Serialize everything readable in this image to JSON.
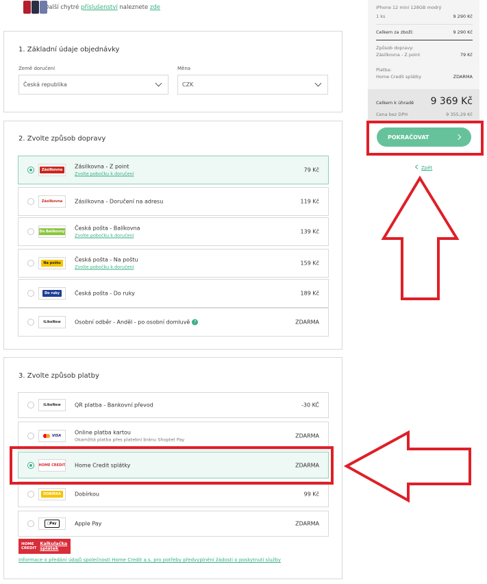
{
  "top_notice": {
    "prefix": "Další chytré",
    "accessories_link": "příslušenství",
    "middle": "naleznete",
    "here_link": "zde"
  },
  "order_basics": {
    "title": "1. Základní údaje objednávky",
    "country_label": "Země doručení",
    "country_value": "Česká republika",
    "currency_label": "Měna",
    "currency_value": "CZK"
  },
  "shipping": {
    "title": "2. Zvolte způsob dopravy",
    "options": [
      {
        "name": "Zásilkovna - Z point",
        "sub": "Zvolte pobočku k doručení",
        "price": "79 Kč",
        "selected": true,
        "logo": "Zásilkovna"
      },
      {
        "name": "Zásilkovna - Doručení na adresu",
        "sub": "",
        "price": "119 Kč",
        "selected": false,
        "logo": "Zásilkovna"
      },
      {
        "name": "Česká pošta - Balíkovna",
        "sub": "Zvolte pobočku k doručení",
        "price": "139 Kč",
        "selected": false,
        "logo": "Do Balíkovny"
      },
      {
        "name": "Česká pošta - Na poštu",
        "sub": "Zvolte pobočku k doručení",
        "price": "159 Kč",
        "selected": false,
        "logo": "Na poštu"
      },
      {
        "name": "Česká pošta - Do ruky",
        "sub": "",
        "price": "189 Kč",
        "selected": false,
        "logo": "Do ruky"
      },
      {
        "name": "Osobní odběr - Anděl - po osobní domluvě",
        "sub": "",
        "price": "ZDARMA",
        "selected": false,
        "logo": "iLikeNew"
      }
    ]
  },
  "payment": {
    "title": "3. Zvolte způsob platby",
    "options": [
      {
        "name": "QR platba - Bankovní převod",
        "sub": "",
        "price": "-30 KČ",
        "selected": false,
        "logo": "iLikeNew"
      },
      {
        "name": "Online platba kartou",
        "sub": "Okamžitá platba přes platební bránu Shoptet Pay",
        "price": "ZDARMA",
        "selected": false,
        "logo": "VISA"
      },
      {
        "name": "Home Credit splátky",
        "sub": "",
        "price": "ZDARMA",
        "selected": true,
        "logo": "HOME CREDIT"
      },
      {
        "name": "Dobírkou",
        "sub": "",
        "price": "99 Kč",
        "selected": false,
        "logo": "DOBÍRKA"
      },
      {
        "name": "Apple Pay",
        "sub": "",
        "price": "ZDARMA",
        "selected": false,
        "logo": "Pay"
      }
    ],
    "hc_badge_line1": "HOME",
    "hc_badge_line2": "CREDIT",
    "hc_calc_line1": "Kalkulačka",
    "hc_calc_line2": "splátek",
    "hc_info": "Informace o předání údajů společnosti Home Credit a.s. pro potřeby předvyplnění žádosti o poskytnutí služby"
  },
  "summary": {
    "product": "iPhone 12 mini 128GB modrý",
    "qty": "1 ks",
    "qty_price": "9 290 Kč",
    "goods_total_label": "Celkem za zboží:",
    "goods_total_value": "9 290 Kč",
    "shipping_label": "Způsob dopravy:",
    "shipping_method": "Zásilkovna - Z point",
    "shipping_price": "79 Kč",
    "payment_label": "Platba:",
    "payment_method": "Home Credit splátky",
    "payment_price": "ZDARMA",
    "total_label": "Celkem k úhradě",
    "total_value": "9 369 Kč",
    "without_vat_label": "Cena bez DPH",
    "without_vat_value": "9 355,29 Kč"
  },
  "actions": {
    "continue_label": "POKRAČOVAT",
    "back_label": "Zpět"
  },
  "annotation_color": "#de1f28"
}
